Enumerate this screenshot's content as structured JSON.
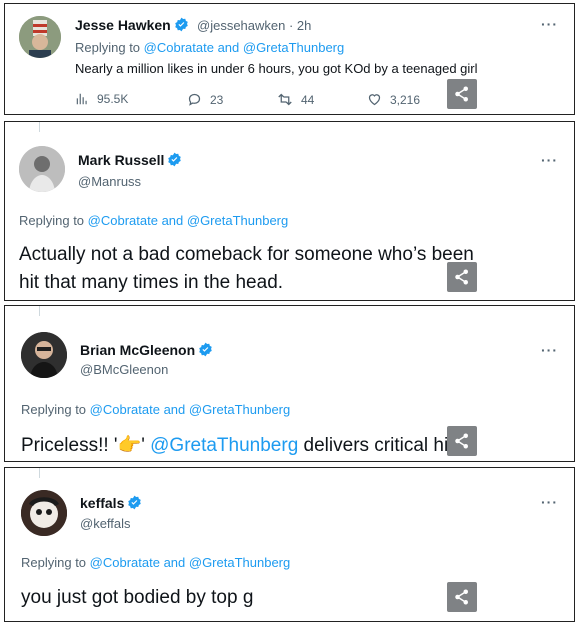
{
  "tweets": [
    {
      "name": "Jesse Hawken",
      "handle": "@jessehawken",
      "time": "· 2h",
      "replying_prefix": "Replying to",
      "replying_to": "@Cobratate and @GretaThunberg",
      "text": "Nearly a million likes in under 6 hours, you got KOd by a teenaged girl",
      "views": "95.5K",
      "replies": "23",
      "retweets": "44",
      "likes": "3,216"
    },
    {
      "name": "Mark Russell",
      "handle": "@Manruss",
      "replying_prefix": "Replying to",
      "replying_to": "@Cobratate and @GretaThunberg",
      "text_line1": "Actually not a bad comeback for someone who’s been",
      "text_line2": "hit that many times in the head."
    },
    {
      "name": "Brian McGleenon",
      "handle": "@BMcGleenon",
      "replying_prefix": "Replying to",
      "replying_to": "@Cobratate and @GretaThunberg",
      "text_pre": "Priceless!! '",
      "text_emoji": "👉",
      "text_mid": "' ",
      "text_mention": "@GretaThunberg",
      "text_post": " delivers critical hit"
    },
    {
      "name": "keffals",
      "handle": "@keffals",
      "replying_prefix": "Replying to",
      "replying_to": "@Cobratate and @GretaThunberg",
      "text": "you just got bodied by top g"
    }
  ],
  "more_label": "···",
  "colors": {
    "accent": "#1d9bf0",
    "muted": "#536471",
    "share_bg": "#7f8285"
  },
  "icons": [
    "verified-badge-icon",
    "more-icon",
    "views-icon",
    "reply-icon",
    "retweet-icon",
    "like-icon",
    "share-icon"
  ]
}
